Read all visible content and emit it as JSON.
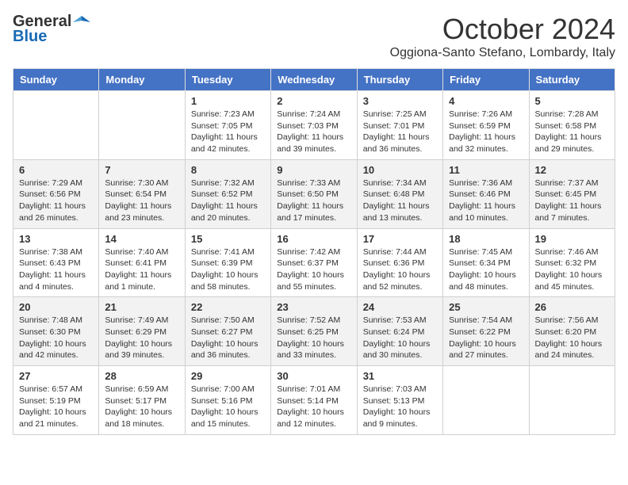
{
  "header": {
    "logo_general": "General",
    "logo_blue": "Blue",
    "month_title": "October 2024",
    "location": "Oggiona-Santo Stefano, Lombardy, Italy"
  },
  "days_of_week": [
    "Sunday",
    "Monday",
    "Tuesday",
    "Wednesday",
    "Thursday",
    "Friday",
    "Saturday"
  ],
  "weeks": [
    [
      {
        "day": "",
        "content": ""
      },
      {
        "day": "",
        "content": ""
      },
      {
        "day": "1",
        "content": "Sunrise: 7:23 AM\nSunset: 7:05 PM\nDaylight: 11 hours and 42 minutes."
      },
      {
        "day": "2",
        "content": "Sunrise: 7:24 AM\nSunset: 7:03 PM\nDaylight: 11 hours and 39 minutes."
      },
      {
        "day": "3",
        "content": "Sunrise: 7:25 AM\nSunset: 7:01 PM\nDaylight: 11 hours and 36 minutes."
      },
      {
        "day": "4",
        "content": "Sunrise: 7:26 AM\nSunset: 6:59 PM\nDaylight: 11 hours and 32 minutes."
      },
      {
        "day": "5",
        "content": "Sunrise: 7:28 AM\nSunset: 6:58 PM\nDaylight: 11 hours and 29 minutes."
      }
    ],
    [
      {
        "day": "6",
        "content": "Sunrise: 7:29 AM\nSunset: 6:56 PM\nDaylight: 11 hours and 26 minutes."
      },
      {
        "day": "7",
        "content": "Sunrise: 7:30 AM\nSunset: 6:54 PM\nDaylight: 11 hours and 23 minutes."
      },
      {
        "day": "8",
        "content": "Sunrise: 7:32 AM\nSunset: 6:52 PM\nDaylight: 11 hours and 20 minutes."
      },
      {
        "day": "9",
        "content": "Sunrise: 7:33 AM\nSunset: 6:50 PM\nDaylight: 11 hours and 17 minutes."
      },
      {
        "day": "10",
        "content": "Sunrise: 7:34 AM\nSunset: 6:48 PM\nDaylight: 11 hours and 13 minutes."
      },
      {
        "day": "11",
        "content": "Sunrise: 7:36 AM\nSunset: 6:46 PM\nDaylight: 11 hours and 10 minutes."
      },
      {
        "day": "12",
        "content": "Sunrise: 7:37 AM\nSunset: 6:45 PM\nDaylight: 11 hours and 7 minutes."
      }
    ],
    [
      {
        "day": "13",
        "content": "Sunrise: 7:38 AM\nSunset: 6:43 PM\nDaylight: 11 hours and 4 minutes."
      },
      {
        "day": "14",
        "content": "Sunrise: 7:40 AM\nSunset: 6:41 PM\nDaylight: 11 hours and 1 minute."
      },
      {
        "day": "15",
        "content": "Sunrise: 7:41 AM\nSunset: 6:39 PM\nDaylight: 10 hours and 58 minutes."
      },
      {
        "day": "16",
        "content": "Sunrise: 7:42 AM\nSunset: 6:37 PM\nDaylight: 10 hours and 55 minutes."
      },
      {
        "day": "17",
        "content": "Sunrise: 7:44 AM\nSunset: 6:36 PM\nDaylight: 10 hours and 52 minutes."
      },
      {
        "day": "18",
        "content": "Sunrise: 7:45 AM\nSunset: 6:34 PM\nDaylight: 10 hours and 48 minutes."
      },
      {
        "day": "19",
        "content": "Sunrise: 7:46 AM\nSunset: 6:32 PM\nDaylight: 10 hours and 45 minutes."
      }
    ],
    [
      {
        "day": "20",
        "content": "Sunrise: 7:48 AM\nSunset: 6:30 PM\nDaylight: 10 hours and 42 minutes."
      },
      {
        "day": "21",
        "content": "Sunrise: 7:49 AM\nSunset: 6:29 PM\nDaylight: 10 hours and 39 minutes."
      },
      {
        "day": "22",
        "content": "Sunrise: 7:50 AM\nSunset: 6:27 PM\nDaylight: 10 hours and 36 minutes."
      },
      {
        "day": "23",
        "content": "Sunrise: 7:52 AM\nSunset: 6:25 PM\nDaylight: 10 hours and 33 minutes."
      },
      {
        "day": "24",
        "content": "Sunrise: 7:53 AM\nSunset: 6:24 PM\nDaylight: 10 hours and 30 minutes."
      },
      {
        "day": "25",
        "content": "Sunrise: 7:54 AM\nSunset: 6:22 PM\nDaylight: 10 hours and 27 minutes."
      },
      {
        "day": "26",
        "content": "Sunrise: 7:56 AM\nSunset: 6:20 PM\nDaylight: 10 hours and 24 minutes."
      }
    ],
    [
      {
        "day": "27",
        "content": "Sunrise: 6:57 AM\nSunset: 5:19 PM\nDaylight: 10 hours and 21 minutes."
      },
      {
        "day": "28",
        "content": "Sunrise: 6:59 AM\nSunset: 5:17 PM\nDaylight: 10 hours and 18 minutes."
      },
      {
        "day": "29",
        "content": "Sunrise: 7:00 AM\nSunset: 5:16 PM\nDaylight: 10 hours and 15 minutes."
      },
      {
        "day": "30",
        "content": "Sunrise: 7:01 AM\nSunset: 5:14 PM\nDaylight: 10 hours and 12 minutes."
      },
      {
        "day": "31",
        "content": "Sunrise: 7:03 AM\nSunset: 5:13 PM\nDaylight: 10 hours and 9 minutes."
      },
      {
        "day": "",
        "content": ""
      },
      {
        "day": "",
        "content": ""
      }
    ]
  ]
}
